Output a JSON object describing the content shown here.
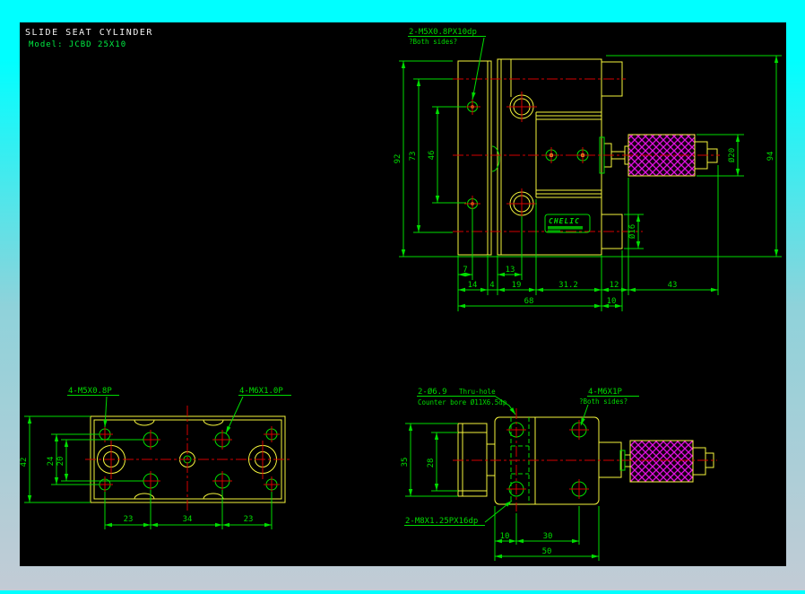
{
  "title_block": {
    "line1": "SLIDE SEAT CYLINDER",
    "line2": "Model: JCBD 25X10"
  },
  "front_view": {
    "thread_label": "2-M5X0.8PX10dp",
    "thread_note": "?Both sides?",
    "brand": "CHELIC",
    "dims": {
      "plate_height": "92",
      "port_span": "73",
      "hole_span": "46",
      "d7": "7",
      "d13": "13",
      "d14": "14",
      "d4": "4",
      "d19": "19",
      "d31_2": "31.2",
      "d12": "12",
      "d43": "43",
      "d68": "68",
      "d10": "10",
      "overall_height": "94",
      "knob_dia": "Ø20",
      "port_dia": "Ø16"
    }
  },
  "top_view": {
    "m5_label": "4-M5X0.8P",
    "m6_label": "4-M6X1.0P",
    "dims": {
      "d42": "42",
      "d24": "24",
      "d20": "20",
      "d23_left": "23",
      "d34": "34",
      "d23_right": "23"
    }
  },
  "side_view": {
    "thru_label": "2-Ø6.9",
    "thru_label2": "Thru-hole",
    "cbore_label": "Counter bore Ø11X6.5dp",
    "m6_label": "4-M6X1P",
    "m6_note": "?Both sides?",
    "m8_label": "2-M8X1.25PX16dp",
    "dims": {
      "d35": "35",
      "d28": "28",
      "d10": "10",
      "d30": "30",
      "d50": "50"
    }
  }
}
